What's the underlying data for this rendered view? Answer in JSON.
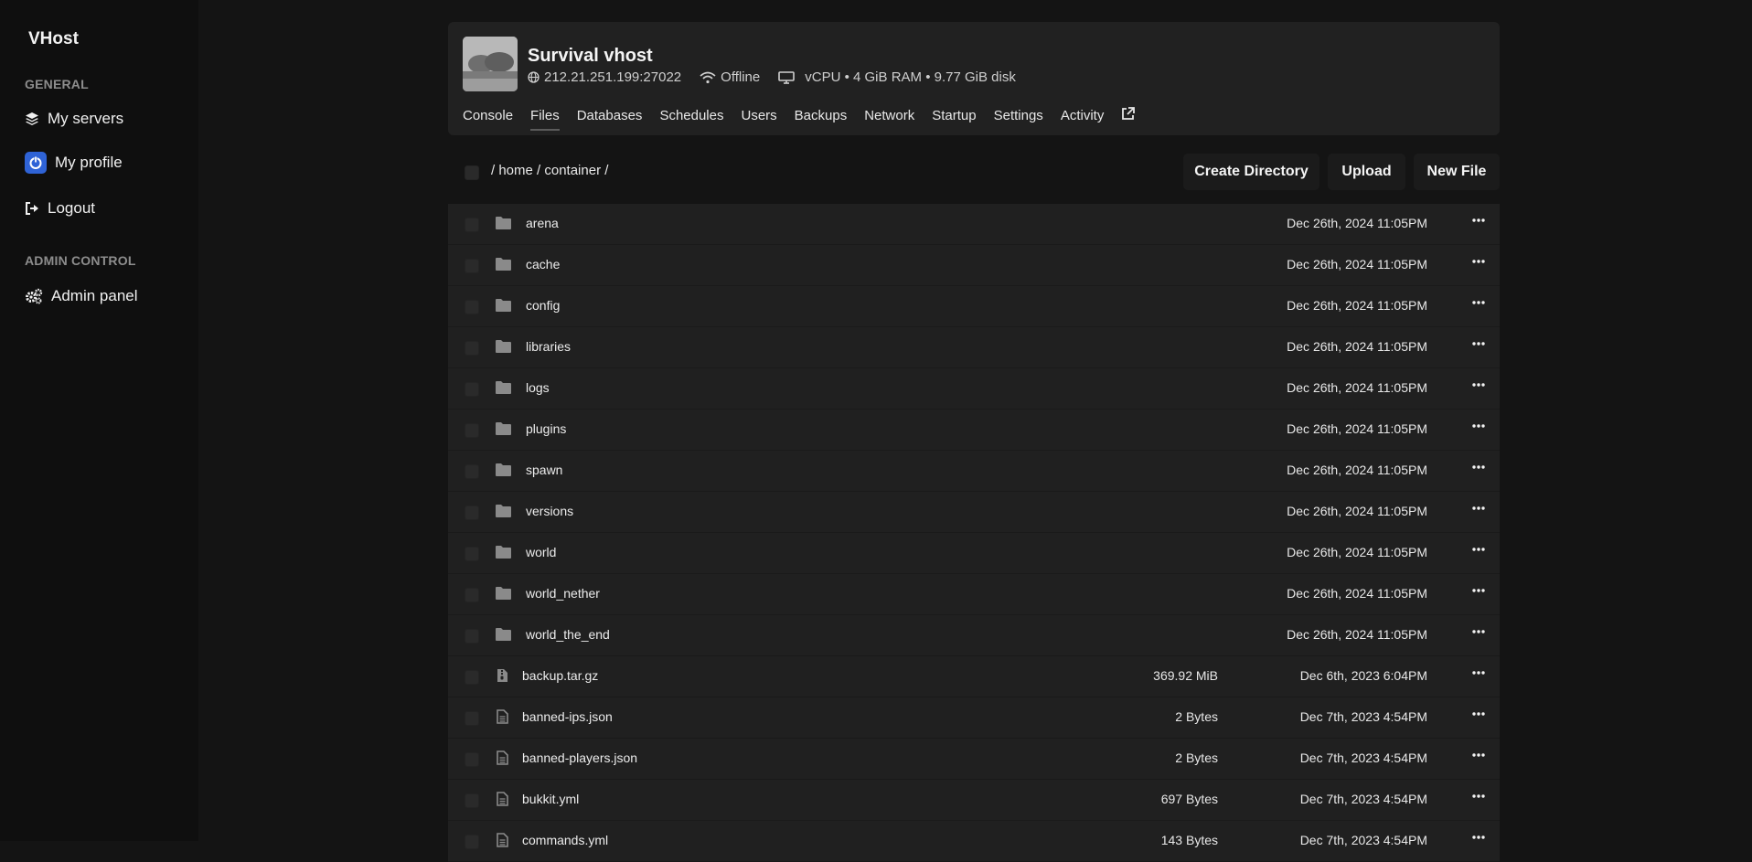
{
  "sidebar": {
    "brand": "VHost",
    "general_title": "GENERAL",
    "items_general": [
      {
        "label": "My servers"
      },
      {
        "label": "My profile"
      },
      {
        "label": "Logout"
      }
    ],
    "admin_title": "ADMIN CONTROL",
    "items_admin": [
      {
        "label": "Admin panel"
      }
    ]
  },
  "server": {
    "name": "Survival vhost",
    "address": "212.21.251.199:27022",
    "status": "Offline",
    "resources": "vCPU • 4 GiB RAM • 9.77 GiB disk"
  },
  "tabs": [
    "Console",
    "Files",
    "Databases",
    "Schedules",
    "Users",
    "Backups",
    "Network",
    "Startup",
    "Settings",
    "Activity"
  ],
  "active_tab": "Files",
  "toolbar": {
    "breadcrumb": "/ home / container /",
    "create_directory": "Create Directory",
    "upload": "Upload",
    "new_file": "New File"
  },
  "files": [
    {
      "name": "arena",
      "type": "folder",
      "size": "",
      "date": "Dec 26th, 2024 11:05PM"
    },
    {
      "name": "cache",
      "type": "folder",
      "size": "",
      "date": "Dec 26th, 2024 11:05PM"
    },
    {
      "name": "config",
      "type": "folder",
      "size": "",
      "date": "Dec 26th, 2024 11:05PM"
    },
    {
      "name": "libraries",
      "type": "folder",
      "size": "",
      "date": "Dec 26th, 2024 11:05PM"
    },
    {
      "name": "logs",
      "type": "folder",
      "size": "",
      "date": "Dec 26th, 2024 11:05PM"
    },
    {
      "name": "plugins",
      "type": "folder",
      "size": "",
      "date": "Dec 26th, 2024 11:05PM"
    },
    {
      "name": "spawn",
      "type": "folder",
      "size": "",
      "date": "Dec 26th, 2024 11:05PM"
    },
    {
      "name": "versions",
      "type": "folder",
      "size": "",
      "date": "Dec 26th, 2024 11:05PM"
    },
    {
      "name": "world",
      "type": "folder",
      "size": "",
      "date": "Dec 26th, 2024 11:05PM"
    },
    {
      "name": "world_nether",
      "type": "folder",
      "size": "",
      "date": "Dec 26th, 2024 11:05PM"
    },
    {
      "name": "world_the_end",
      "type": "folder",
      "size": "",
      "date": "Dec 26th, 2024 11:05PM"
    },
    {
      "name": "backup.tar.gz",
      "type": "archive",
      "size": "369.92 MiB",
      "date": "Dec 6th, 2023 6:04PM"
    },
    {
      "name": "banned-ips.json",
      "type": "file",
      "size": "2 Bytes",
      "date": "Dec 7th, 2023 4:54PM"
    },
    {
      "name": "banned-players.json",
      "type": "file",
      "size": "2 Bytes",
      "date": "Dec 7th, 2023 4:54PM"
    },
    {
      "name": "bukkit.yml",
      "type": "file",
      "size": "697 Bytes",
      "date": "Dec 7th, 2023 4:54PM"
    },
    {
      "name": "commands.yml",
      "type": "file",
      "size": "143 Bytes",
      "date": "Dec 7th, 2023 4:54PM"
    }
  ],
  "colors": {
    "background": "#141414",
    "sidebar": "#0f0f0f",
    "card": "#212121",
    "row": "#202020",
    "accent_profile": "#2f63d6",
    "icon_grey": "#8a8a8a"
  },
  "icons": {
    "servers": "layers-icon",
    "profile": "power-icon",
    "logout": "sign-out-icon",
    "admin": "gears-icon",
    "address": "globe-icon",
    "status": "wifi-icon",
    "resources": "monitor-icon",
    "external": "external-link-icon",
    "folder": "folder-icon",
    "file": "file-icon",
    "archive": "archive-icon",
    "more": "ellipsis-icon"
  }
}
